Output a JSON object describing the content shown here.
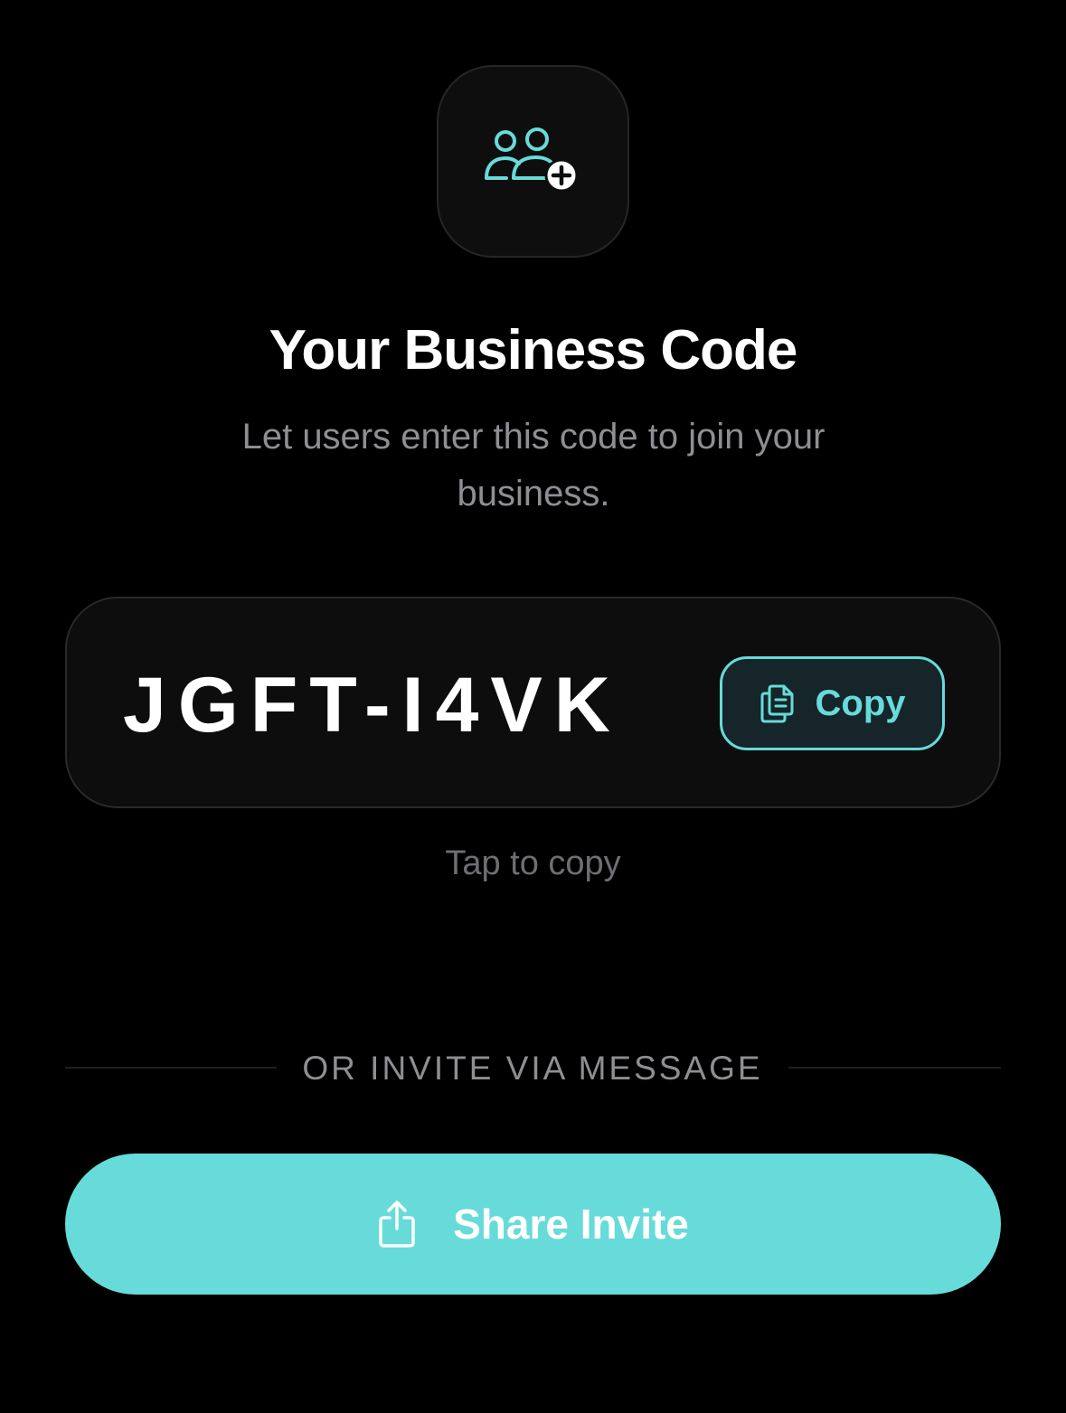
{
  "header": {
    "icon": "add-users-icon",
    "title": "Your Business Code",
    "subtitle": "Let users enter this code to join your business."
  },
  "code_card": {
    "code": "JGFT-I4VK",
    "copy_label": "Copy",
    "copy_icon": "copy-icon",
    "hint": "Tap to copy"
  },
  "divider": {
    "label": "OR INVITE VIA MESSAGE"
  },
  "share": {
    "label": "Share Invite",
    "icon": "share-icon"
  },
  "colors": {
    "accent": "#67dbd9",
    "background": "#000000",
    "card": "#0d0d0d",
    "muted_text": "#8e8e93"
  }
}
